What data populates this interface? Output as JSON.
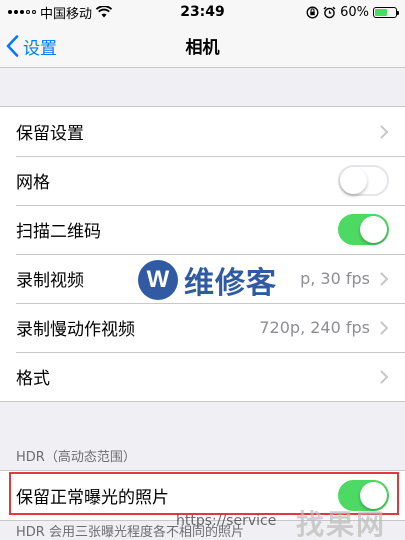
{
  "status_bar": {
    "carrier": "中国移动",
    "time": "23:49",
    "battery_percent": "60%",
    "battery_level": 0.6,
    "icons": [
      "signal-icon",
      "wifi-icon",
      "rotation-lock-icon",
      "alarm-icon",
      "battery-icon"
    ]
  },
  "nav": {
    "back_label": "设置",
    "title": "相机"
  },
  "group1": {
    "rows": [
      {
        "label": "保留设置",
        "type": "chevron"
      },
      {
        "label": "网格",
        "type": "toggle",
        "on": false
      },
      {
        "label": "扫描二维码",
        "type": "toggle",
        "on": true
      },
      {
        "label": "录制视频",
        "type": "chevron",
        "detail": "p, 30 fps"
      },
      {
        "label": "录制慢动作视频",
        "type": "chevron",
        "detail": "720p, 240 fps"
      },
      {
        "label": "格式",
        "type": "chevron"
      }
    ]
  },
  "hdr": {
    "header": "HDR（高动态范围）",
    "row_label": "保留正常曝光的照片",
    "row_on": true,
    "footer": "HDR 会用三张曝光程度各不相同的照片"
  },
  "watermark": {
    "logo_letter": "W",
    "logo_text": "维修客",
    "url": "https://service",
    "corner_text": "找果网"
  },
  "colors": {
    "accent": "#007aff",
    "toggle_on": "#4cd964",
    "highlight": "#e03a3a",
    "background": "#efeff4"
  }
}
